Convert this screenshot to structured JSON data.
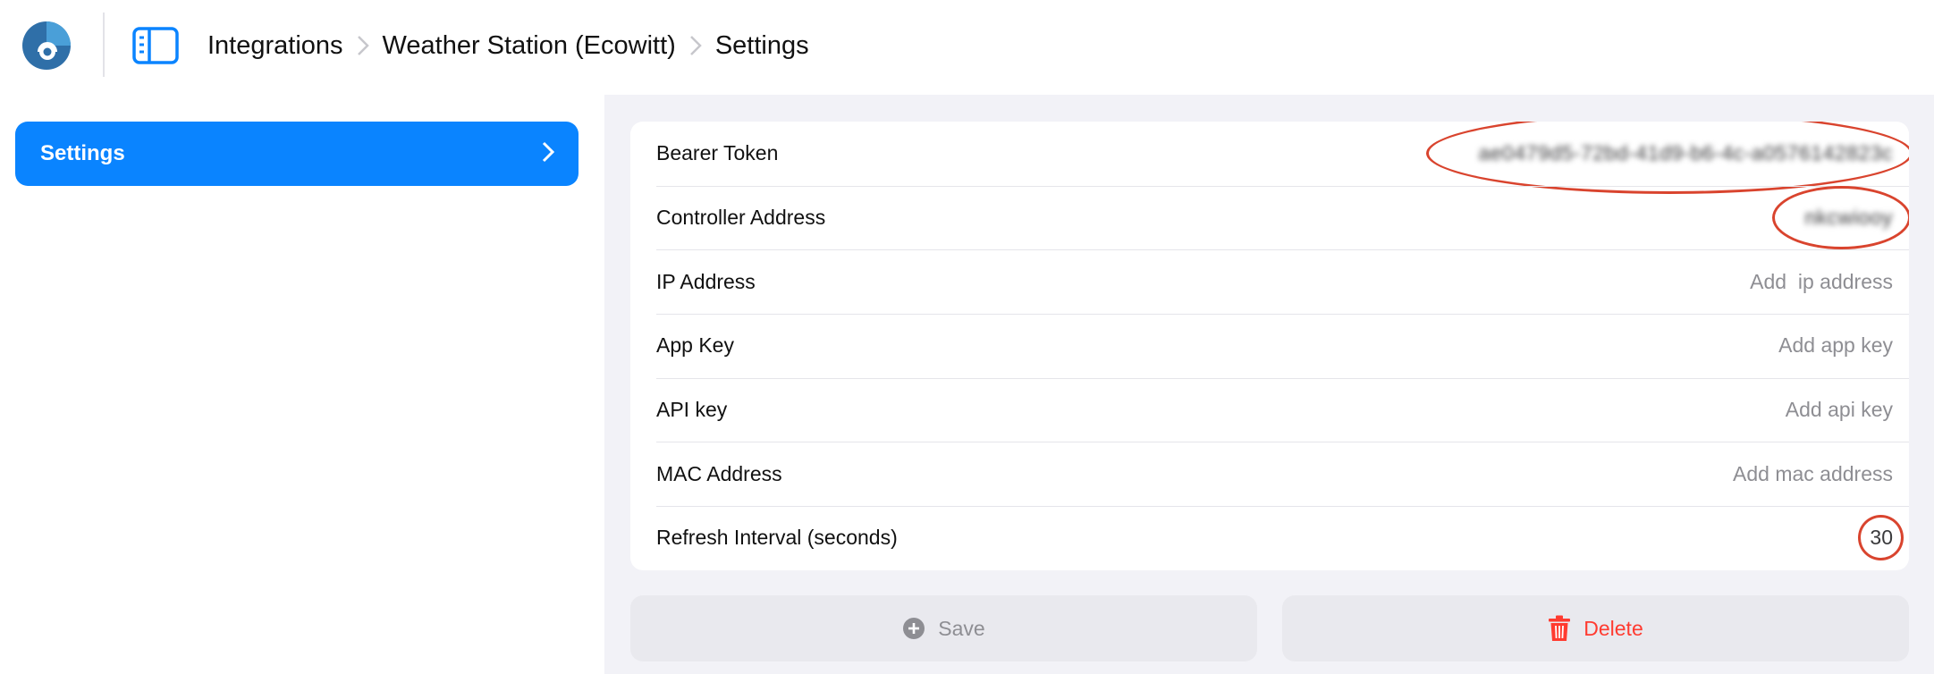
{
  "header": {
    "breadcrumbs": [
      "Integrations",
      "Weather Station (Ecowitt)",
      "Settings"
    ]
  },
  "sidebar": {
    "items": [
      {
        "label": "Settings"
      }
    ]
  },
  "settings": {
    "rows": [
      {
        "label": "Bearer Token",
        "value": "ae0479d5-72bd-41d9-b6-4c-a0576142823c"
      },
      {
        "label": "Controller Address",
        "value": "nkcwiooy"
      },
      {
        "label": "IP Address",
        "placeholder": "Add  ip address"
      },
      {
        "label": "App Key",
        "placeholder": "Add app key"
      },
      {
        "label": "API key",
        "placeholder": "Add api key"
      },
      {
        "label": "MAC Address",
        "placeholder": "Add mac address"
      },
      {
        "label": "Refresh Interval (seconds)",
        "value": "30"
      }
    ]
  },
  "actions": {
    "save_label": "Save",
    "delete_label": "Delete"
  },
  "colors": {
    "accent": "#0a84ff",
    "danger": "#ff3b30",
    "annotation": "#d9442e",
    "background": "#f2f2f7"
  },
  "icons": [
    "chameleon-logo-icon",
    "sidebar-toggle-icon",
    "chevron-right-icon",
    "plus-circle-icon",
    "trash-icon"
  ]
}
